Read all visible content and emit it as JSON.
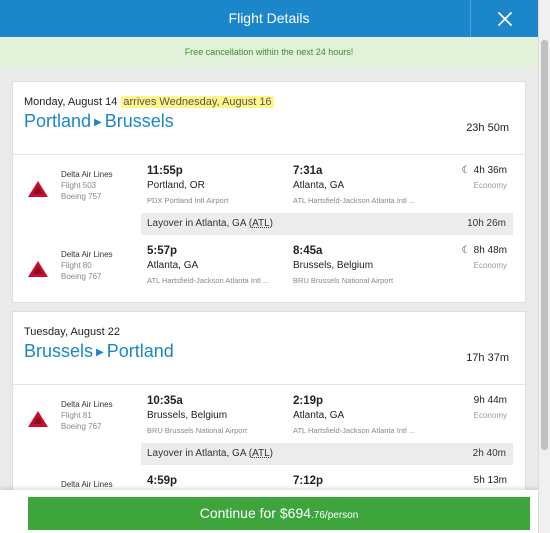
{
  "header": {
    "title": "Flight Details",
    "close_icon": "close-icon"
  },
  "notice": "Free cancellation within the next 24 hours!",
  "colors": {
    "header": "#1b86c9",
    "notice_bg": "#e2f2da",
    "notice_text": "#3b8c2a",
    "route": "#1a87c8",
    "cta": "#3ea53c",
    "highlight": "#fff68a",
    "delta_red": "#c8102e"
  },
  "outbound": {
    "date": "Monday, August 14",
    "arrives_note": "arrives Wednesday, August 16",
    "from": "Portland",
    "to": "Brussels",
    "total_duration": "23h 50m",
    "segments": [
      {
        "airline": "Delta Air Lines",
        "flight": "Flight 503",
        "aircraft": "Boeing 757",
        "dep_time": "11:55p",
        "dep_city": "Portland, OR",
        "dep_airport": "PDX Portland Intl Airport",
        "arr_time": "7:31a",
        "arr_city": "Atlanta, GA",
        "arr_airport": "ATL Hartsfield-Jackson Atlanta Intl ...",
        "duration": "4h 36m",
        "cabin": "Economy",
        "overnight_icon": "moon-icon"
      },
      {
        "airline": "Delta Air Lines",
        "flight": "Flight 80",
        "aircraft": "Boeing 767",
        "dep_time": "5:57p",
        "dep_city": "Atlanta, GA",
        "dep_airport": "ATL Hartsfield-Jackson Atlanta Intl ...",
        "arr_time": "8:45a",
        "arr_city": "Brussels, Belgium",
        "arr_airport": "BRU Brussels National Airport",
        "duration": "8h 48m",
        "cabin": "Economy",
        "overnight_icon": "moon-icon"
      }
    ],
    "layover": {
      "prefix": "Layover in Atlanta, GA (",
      "code": "ATL",
      "suffix": ")",
      "duration": "10h 26m"
    }
  },
  "return": {
    "date": "Tuesday, August 22",
    "from": "Brussels",
    "to": "Portland",
    "total_duration": "17h 37m",
    "segments": [
      {
        "airline": "Delta Air Lines",
        "flight": "Flight 81",
        "aircraft": "Boeing 767",
        "dep_time": "10:35a",
        "dep_city": "Brussels, Belgium",
        "dep_airport": "BRU Brussels National Airport",
        "arr_time": "2:19p",
        "arr_city": "Atlanta, GA",
        "arr_airport": "ATL Hartsfield-Jackson Atlanta Intl ...",
        "duration": "9h 44m",
        "cabin": "Economy"
      },
      {
        "airline": "Delta Air Lines",
        "dep_time": "4:59p",
        "arr_time": "7:12p",
        "duration": "5h 13m"
      }
    ],
    "layover": {
      "prefix": "Layover in Atlanta, GA (",
      "code": "ATL",
      "suffix": ")",
      "duration": "2h 40m"
    }
  },
  "cta": {
    "label": "Continue for ",
    "price_main": "$694",
    "price_cents": ".76/person"
  }
}
